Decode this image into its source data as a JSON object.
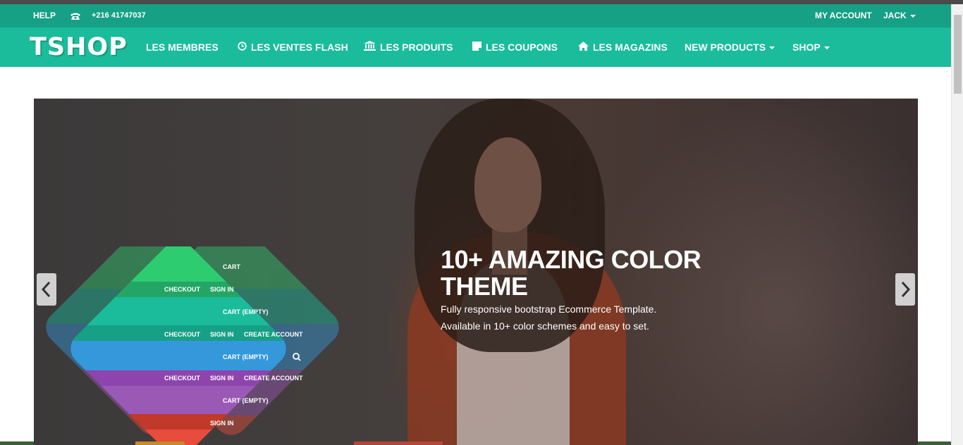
{
  "topbar": {
    "help": "HELP",
    "phone": "+216 41747037",
    "my_account": "MY ACCOUNT",
    "user": "JACK"
  },
  "brand": {
    "logo": "TSHOP"
  },
  "nav": {
    "membres": "LES MEMBRES",
    "ventes_flash": "LES VENTES FLASH",
    "produits": "LES PRODUITS",
    "coupons": "LES COUPONS",
    "magazins": "LES MAGAZINS",
    "new_products": "NEW PRODUCTS",
    "shop": "SHOP"
  },
  "hero": {
    "title_line1": "10+ AMAZING COLOR",
    "title_line2": "THEME",
    "text_line1": "Fully responsive bootstrap Ecommerce Template.",
    "text_line2": "Available in 10+ color schemes and easy to set."
  },
  "themes_preview": {
    "labels": {
      "cart": "CART",
      "cart_empty": "CART (EMPTY)",
      "checkout": "CHECKOUT",
      "sign_in": "SIGN IN",
      "create_account": "CREATE ACCOUNT"
    }
  },
  "colors": {
    "topbar": "#16a085",
    "navbar": "#1abc9c",
    "theme_green": "#2ecc71",
    "theme_teal": "#1abc9c",
    "theme_blue": "#3498db",
    "theme_purple": "#9b59b6",
    "theme_red": "#e74c3c"
  }
}
